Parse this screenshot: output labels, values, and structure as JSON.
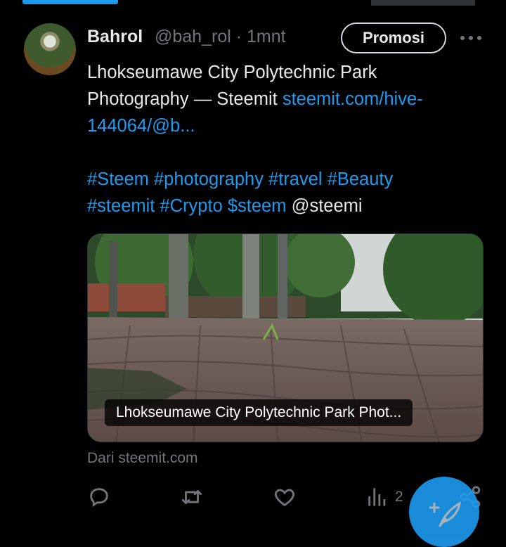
{
  "tweet": {
    "author_name": "Bahrol",
    "handle": "@bah_rol",
    "separator": "·",
    "time": "1mnt",
    "promo_label": "Promosi",
    "text_line1": "Lhokseumawe City Polytechnic Park",
    "text_line2_plain": "Photography — Steemit ",
    "text_link_part1": "steemit.com/hive-",
    "text_link_part2": "144064/@b...",
    "hashtags": [
      "#Steem",
      "#photography",
      "#travel",
      "#Beauty",
      "#steemit",
      "#Crypto",
      "$steem"
    ],
    "mention": "@steemi",
    "card_caption": "Lhokseumawe City Polytechnic Park Phot...",
    "source": "Dari steemit.com",
    "views_count": "2"
  },
  "icons": {
    "reply": "reply-icon",
    "retweet": "retweet-icon",
    "like": "heart-icon",
    "views": "views-chart-icon",
    "share": "share-icon",
    "more": "more-dots-icon",
    "compose": "compose-feather-icon"
  },
  "colors": {
    "accent": "#1d9bf0",
    "text": "#e7e9ea",
    "muted": "#71767b",
    "background": "#000000"
  }
}
